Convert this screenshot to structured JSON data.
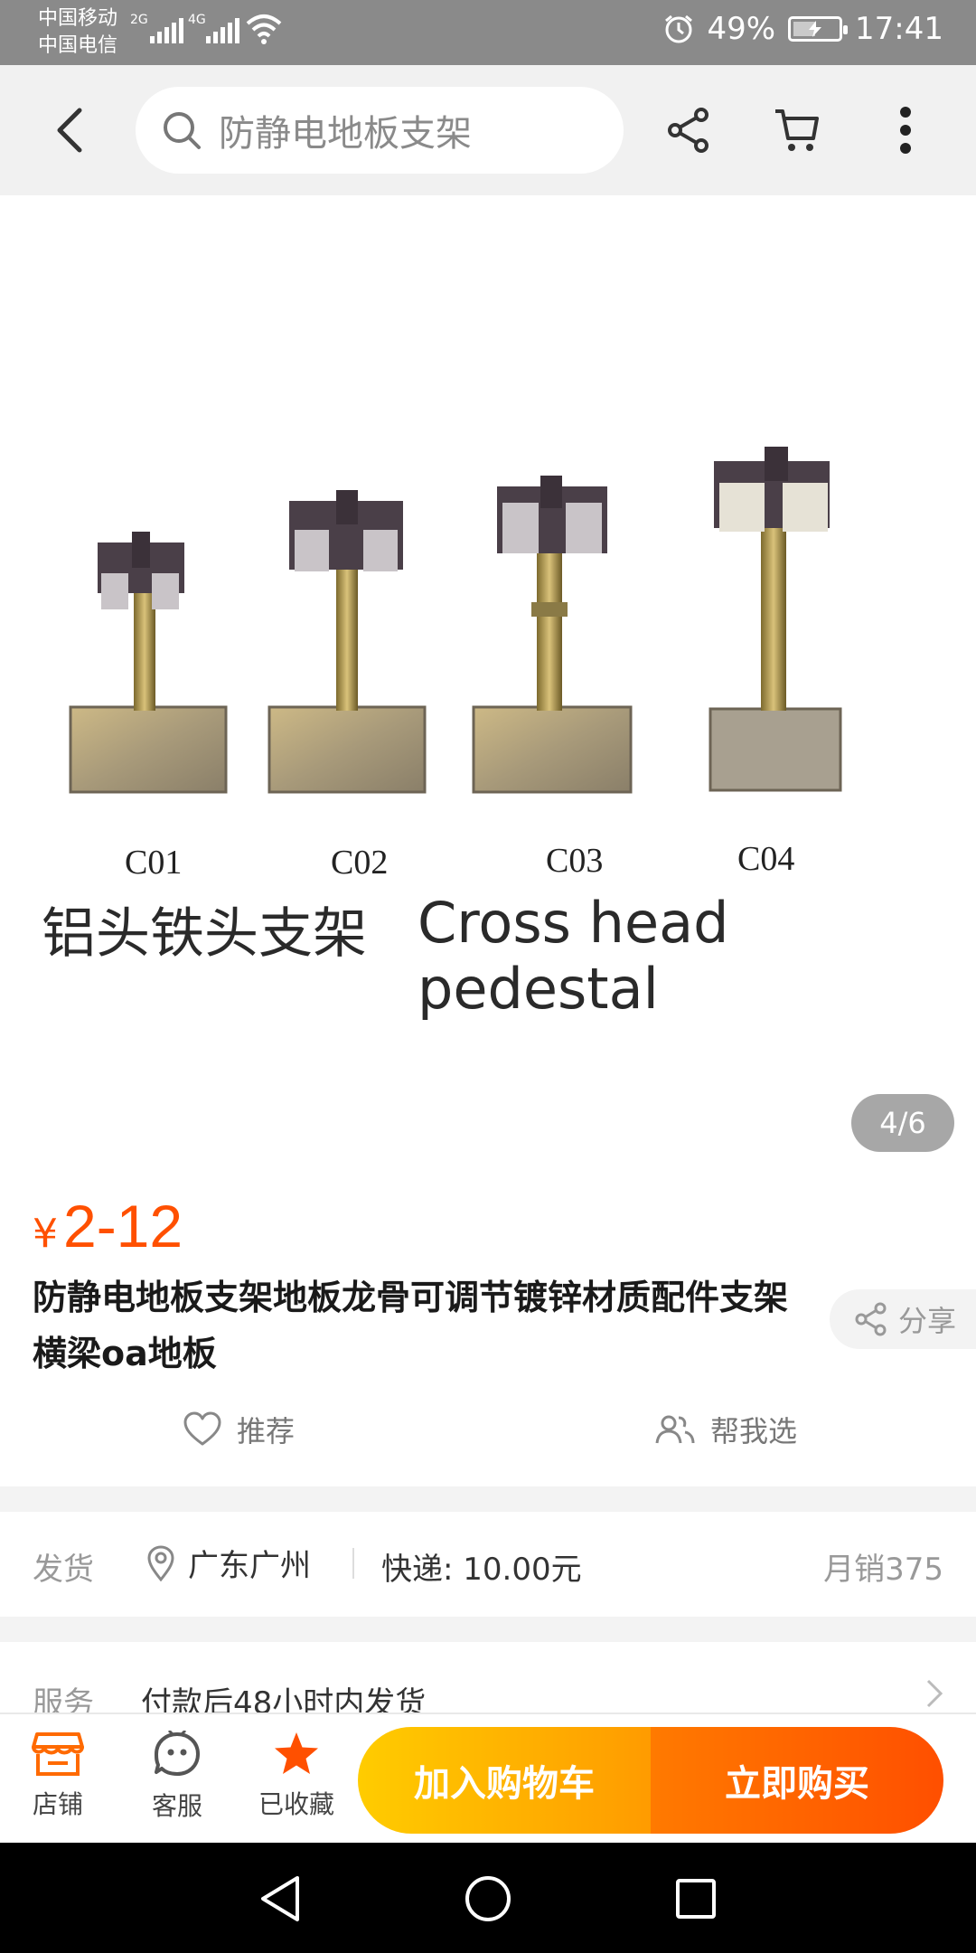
{
  "status_bar": {
    "carrier1": "中国移动",
    "carrier2": "中国电信",
    "net1": "2G",
    "net2": "4G",
    "battery": "49%",
    "battery_level": 0.49,
    "time": "17:41"
  },
  "topnav": {
    "search_text": "防静电地板支架"
  },
  "gallery": {
    "models": [
      "C01",
      "C02",
      "C03",
      "C04"
    ],
    "caption_cn": "铝头铁头支架",
    "caption_en": "Cross head pedestal",
    "counter": "4/6"
  },
  "product": {
    "currency": "¥",
    "price": "2-12",
    "title": "防静电地板支架地板龙骨可调节镀锌材质配件支架横梁oa地板",
    "share": "分享",
    "recommend": "推荐",
    "help_choose": "帮我选"
  },
  "shipping": {
    "label": "发货",
    "location": "广东广州",
    "express": "快递: 10.00元",
    "monthly_sales": "月销375"
  },
  "service": {
    "label": "服务",
    "value": "付款后48小时内发货"
  },
  "bottom_bar": {
    "shop": "店铺",
    "support": "客服",
    "favorited": "已收藏",
    "add_to_cart": "加入购物车",
    "buy_now": "立即购买"
  },
  "colors": {
    "accent": "#ff5000",
    "cart_start": "#ffcc00",
    "buy_end": "#ff4f00"
  }
}
